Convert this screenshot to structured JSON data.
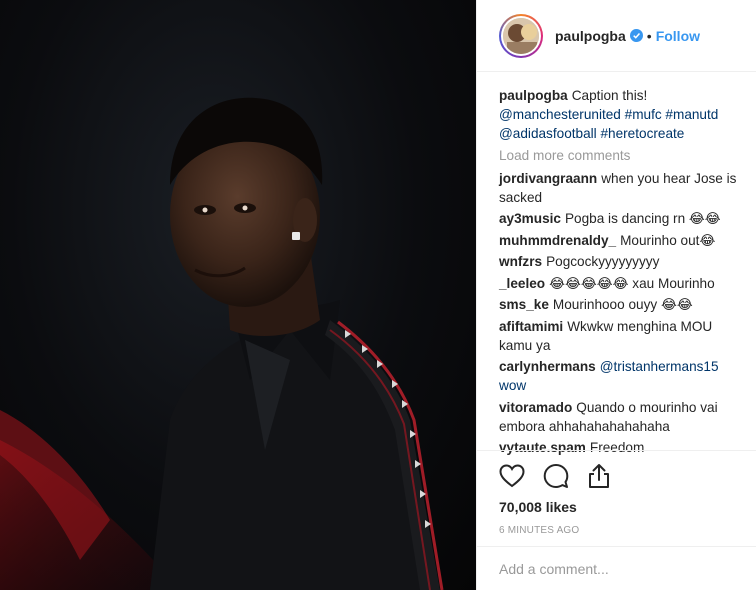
{
  "header": {
    "username": "paulpogba",
    "separator": "•",
    "follow_label": "Follow"
  },
  "caption": {
    "username": "paulpogba",
    "text": "Caption this!",
    "line2": "@manchesterunited #mufc #manutd",
    "line3": "@adidasfootball #heretocreate"
  },
  "load_more_label": "Load more comments",
  "comments": [
    {
      "user": "jordivangraann",
      "text": "when you hear Jose is sacked"
    },
    {
      "user": "ay3music",
      "text": "Pogba is dancing rn 😂😂"
    },
    {
      "user": "muhmmdrenaldy_",
      "text": "Mourinho out😂"
    },
    {
      "user": "wnfzrs",
      "text": "Pogcockyyyyyyyyy"
    },
    {
      "user": "_leeleo",
      "text": "😂😂😂😂😂 xau Mourinho"
    },
    {
      "user": "sms_ke",
      "text": "Mourinhooo ouyy 😂😂"
    },
    {
      "user": "afiftamimi",
      "text": "Wkwkw menghina MOU kamu ya"
    },
    {
      "user": "carlynhermans",
      "text": "@tristanhermans15 wow"
    },
    {
      "user": "vitoramado",
      "text": "Quando o mourinho vai embora ahhahahahahahaha"
    },
    {
      "user": "vytaute.spam",
      "text": "Freedom"
    }
  ],
  "likes": "70,008 likes",
  "timestamp": "6 MINUTES AGO",
  "add_comment_placeholder": "Add a comment...",
  "colors": {
    "link_blue": "#3897f0",
    "tag_blue": "#003569",
    "muted": "#999999",
    "text": "#262626"
  },
  "icons": [
    "heart-icon",
    "comment-icon",
    "share-icon",
    "verified-badge-icon"
  ]
}
